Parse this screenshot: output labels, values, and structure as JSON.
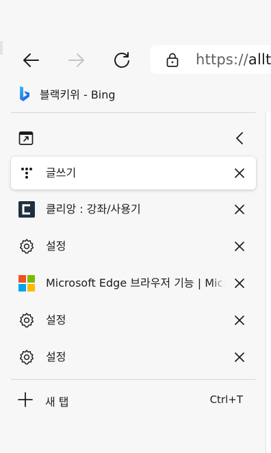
{
  "toolbar": {
    "back_icon": "arrow-left-icon",
    "forward_icon": "arrow-right-icon",
    "refresh_icon": "refresh-icon",
    "lock_icon": "lock-icon",
    "url_scheme": "https://",
    "url_host": "allt"
  },
  "favorites": {
    "items": [
      {
        "label": "블랙키위 - Bing",
        "icon": "bing-icon"
      }
    ]
  },
  "panel": {
    "header": {
      "pin_icon": "panel-pin-icon",
      "collapse_icon": "chevron-left-icon"
    },
    "tabs": [
      {
        "title": "글쓰기",
        "icon": "dots-app-icon",
        "active": true
      },
      {
        "title": "클리앙 : 강좌/사용기",
        "icon": "clien-logo-icon",
        "active": false
      },
      {
        "title": "설정",
        "icon": "gear-icon",
        "active": false
      },
      {
        "title": "Microsoft Edge 브라우저 기능 | Microsoft",
        "icon": "microsoft-logo-icon",
        "active": false
      },
      {
        "title": "설정",
        "icon": "gear-icon",
        "active": false
      },
      {
        "title": "설정",
        "icon": "gear-icon",
        "active": false
      }
    ],
    "new_tab": {
      "label": "새 탭",
      "shortcut": "Ctrl+T"
    }
  },
  "colors": {
    "background": "#f7f7f7",
    "active_tab": "#ffffff",
    "bing_blue": "#1b7ad8",
    "clien_dark": "#1f2f3f"
  }
}
